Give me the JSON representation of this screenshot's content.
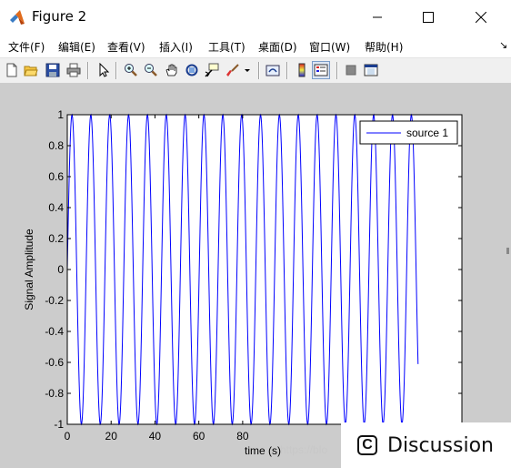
{
  "window": {
    "title": "Figure 2",
    "controls": {
      "minimize": "minimize",
      "maximize": "maximize",
      "close": "close"
    }
  },
  "menu": {
    "items": [
      "文件(F)",
      "编辑(E)",
      "查看(V)",
      "插入(I)",
      "工具(T)",
      "桌面(D)",
      "窗口(W)",
      "帮助(H)"
    ],
    "overflow_arrow": "↘"
  },
  "toolbar": {
    "buttons": [
      "new-figure-icon",
      "open-file-icon",
      "save-icon",
      "print-icon",
      "edit-plot-icon",
      "zoom-in-icon",
      "zoom-out-icon",
      "pan-icon",
      "rotate-3d-icon",
      "data-cursor-icon",
      "brush-icon",
      "brush-dropdown-icon",
      "link-plot-icon",
      "insert-colorbar-icon",
      "insert-legend-icon",
      "hide-plot-tools-icon",
      "show-plot-tools-icon"
    ]
  },
  "chart_data": {
    "type": "line",
    "xlabel": "time (s)",
    "ylabel": "Signal Amplitude",
    "xlim": [
      0,
      180
    ],
    "ylim": [
      -1,
      1
    ],
    "xticks": [
      0,
      20,
      40,
      60,
      80
    ],
    "yticks": [
      1,
      0.8,
      0.6,
      0.4,
      0.2,
      0,
      -0.2,
      -0.4,
      -0.6,
      -0.8,
      -1
    ],
    "ytick_labels": [
      "1",
      "0.8",
      "0.6",
      "0.4",
      "0.2",
      "0",
      "-0.2",
      "-0.4",
      "-0.6",
      "-0.8",
      "-1"
    ],
    "grid": false,
    "legend_position": "top-right",
    "series": [
      {
        "name": "source 1",
        "color": "#0000ff",
        "signal": "sinusoid",
        "amplitude": 1,
        "period_s": 8.6,
        "x_start": 0,
        "x_end": 160
      }
    ]
  },
  "watermark": {
    "text": "Discussion",
    "url_fragment": "https://blo"
  }
}
